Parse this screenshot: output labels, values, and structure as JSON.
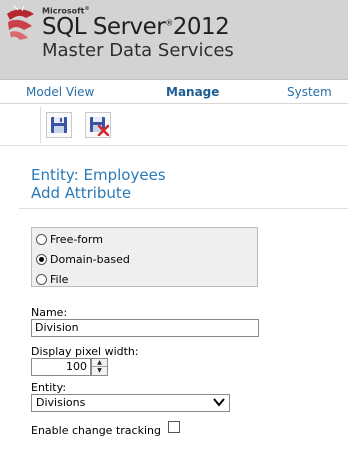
{
  "banner": {
    "brand_small": "Microsoft",
    "product": "SQL Server",
    "version": "2012",
    "subtitle": "Master Data Services",
    "logo_icon": "sql-server-logo-icon"
  },
  "nav": {
    "items": [
      {
        "label": "Model View",
        "active": false
      },
      {
        "label": "Manage",
        "active": true
      },
      {
        "label": "System",
        "active": false
      }
    ]
  },
  "toolbar": {
    "buttons": [
      {
        "icon": "save-icon"
      },
      {
        "icon": "save-and-close-icon"
      }
    ]
  },
  "page": {
    "entity_line": "Entity: Employees",
    "title": "Add Attribute"
  },
  "attribute_type": {
    "options": [
      {
        "label": "Free-form",
        "selected": false
      },
      {
        "label": "Domain-based",
        "selected": true
      },
      {
        "label": "File",
        "selected": false
      }
    ]
  },
  "form": {
    "name_label": "Name:",
    "name_value": "Division",
    "width_label": "Display pixel width:",
    "width_value": "100",
    "entity_label": "Entity:",
    "entity_value": "Divisions",
    "tracking_label": "Enable change tracking",
    "tracking_checked": false
  },
  "colors": {
    "accent": "#2b7ab8",
    "banner_bg": "#d3d3d3"
  }
}
